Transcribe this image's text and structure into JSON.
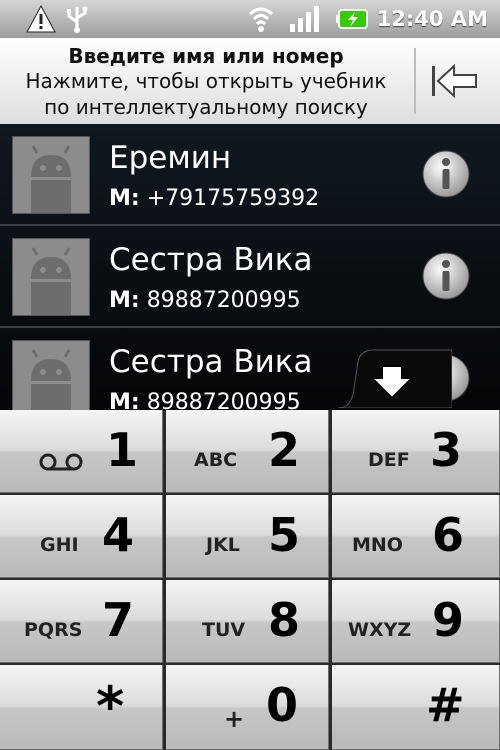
{
  "status_bar": {
    "time": "12:40 AM",
    "icons": [
      "warning-icon",
      "usb-icon",
      "wifi-icon",
      "signal-icon",
      "battery-charging-icon"
    ]
  },
  "search": {
    "title": "Введите имя или номер",
    "hint_line1": "Нажмите, чтобы открыть учебник",
    "hint_line2": "по интеллектуальному поиску",
    "backspace_icon": "backspace-arrow-icon"
  },
  "contacts": [
    {
      "name": "Еремин",
      "type_prefix": "М:",
      "number": "+79175759392"
    },
    {
      "name": "Сестра Вика",
      "type_prefix": "М:",
      "number": "89887200995"
    },
    {
      "name": "Сестра Вика",
      "type_prefix": "М:",
      "number": "89887200995"
    }
  ],
  "keypad": {
    "keys": [
      {
        "digit": "1",
        "letters": ""
      },
      {
        "digit": "2",
        "letters": "ABC"
      },
      {
        "digit": "3",
        "letters": "DEF"
      },
      {
        "digit": "4",
        "letters": "GHI"
      },
      {
        "digit": "5",
        "letters": "JKL"
      },
      {
        "digit": "6",
        "letters": "MNO"
      },
      {
        "digit": "7",
        "letters": "PQRS"
      },
      {
        "digit": "8",
        "letters": "TUV"
      },
      {
        "digit": "9",
        "letters": "WXYZ"
      },
      {
        "digit": "*",
        "letters": ""
      },
      {
        "digit": "0",
        "letters": "+"
      },
      {
        "digit": "#",
        "letters": ""
      }
    ]
  },
  "colors": {
    "status_bar": "#b0b0b0",
    "list_bg": "#0b1016",
    "battery_green": "#33cc00"
  }
}
